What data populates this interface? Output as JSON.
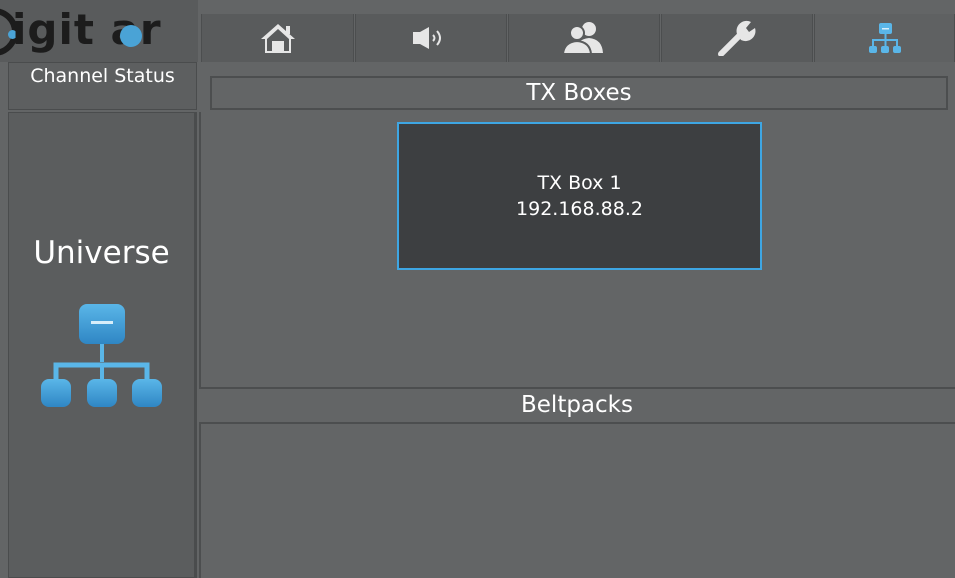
{
  "brand": {
    "logo_text": "igit  ar",
    "accent": "#4aa3d6"
  },
  "sidebar": {
    "channel_status": "Channel Status",
    "universe_label": "Universe",
    "universe_icon": "network-hierarchy-icon"
  },
  "nav": {
    "tabs": [
      {
        "icon": "home-icon"
      },
      {
        "icon": "speaker-icon"
      },
      {
        "icon": "users-icon"
      },
      {
        "icon": "wrench-icon"
      },
      {
        "icon": "network-hierarchy-icon",
        "active": true
      }
    ]
  },
  "main": {
    "tx_header": "TX Boxes",
    "tx_boxes": [
      {
        "name": "TX Box 1",
        "ip": "192.168.88.2"
      }
    ],
    "beltpacks_header": "Beltpacks"
  },
  "colors": {
    "background": "#636566",
    "card": "#3d3f41",
    "highlight": "#3ea6e3"
  }
}
